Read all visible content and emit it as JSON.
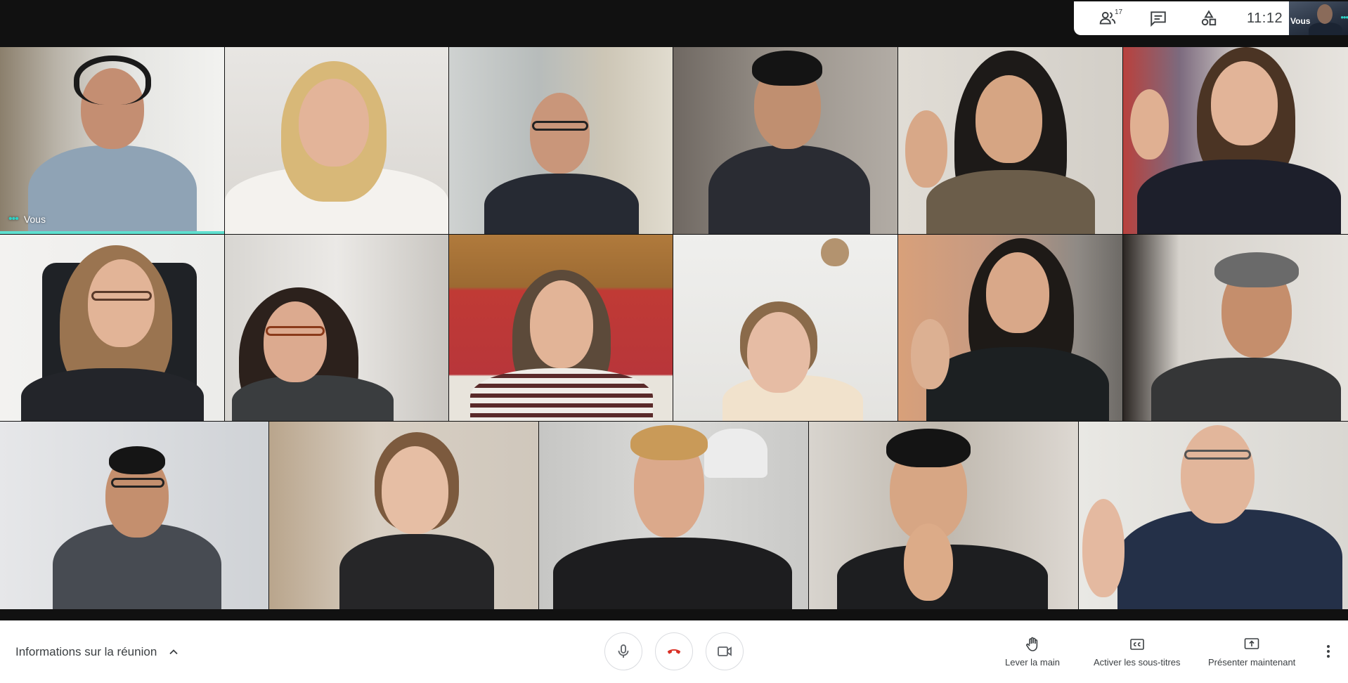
{
  "topbar": {
    "participants_count": "17",
    "clock": "11:12",
    "self_preview_label": "Vous"
  },
  "grid": {
    "self_label": "Vous"
  },
  "bottombar": {
    "meeting_info_label": "Informations sur la réunion",
    "raise_hand_label": "Lever la main",
    "captions_label": "Activer les sous-titres",
    "present_label": "Présenter maintenant"
  },
  "colors": {
    "accent_teal": "#5fe0d0",
    "hangup_red": "#d93025",
    "icon_gray": "#5f6368",
    "text_gray": "#3c4043"
  }
}
